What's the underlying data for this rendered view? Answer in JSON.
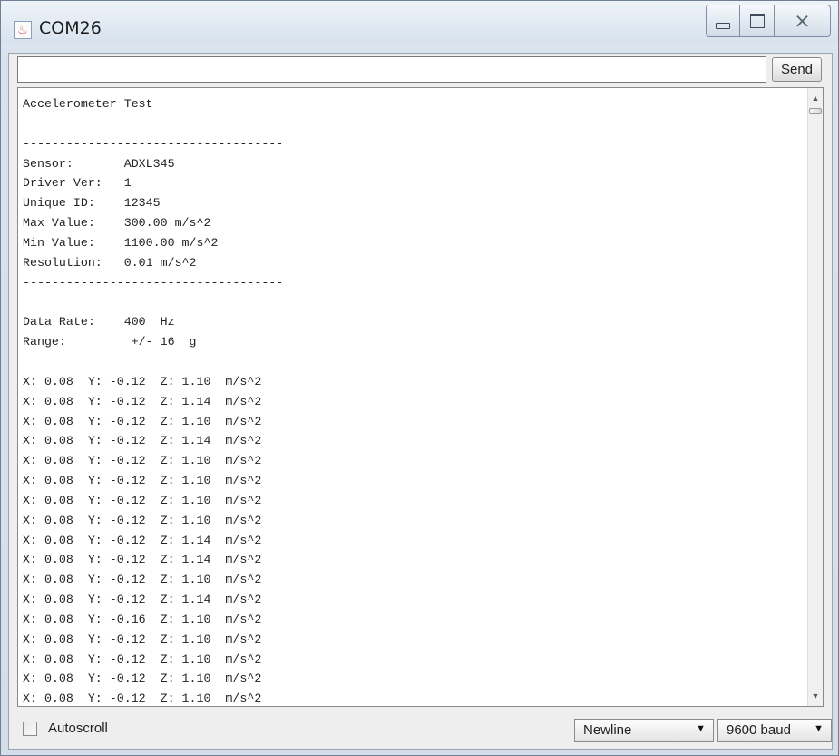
{
  "window": {
    "title": "COM26",
    "icon": "java-cup-icon",
    "buttons": {
      "minimize_icon": "minimize-icon",
      "maximize_icon": "maximize-icon",
      "close_glyph": "⨯"
    }
  },
  "send_bar": {
    "input_value": "",
    "send_label": "Send"
  },
  "serial_output": {
    "lines": [
      "Accelerometer Test",
      "",
      "------------------------------------",
      "Sensor:       ADXL345",
      "Driver Ver:   1",
      "Unique ID:    12345",
      "Max Value:    300.00 m/s^2",
      "Min Value:    1100.00 m/s^2",
      "Resolution:   0.01 m/s^2",
      "------------------------------------",
      "",
      "Data Rate:    400  Hz",
      "Range:         +/- 16  g",
      "",
      "X: 0.08  Y: -0.12  Z: 1.10  m/s^2",
      "X: 0.08  Y: -0.12  Z: 1.14  m/s^2",
      "X: 0.08  Y: -0.12  Z: 1.10  m/s^2",
      "X: 0.08  Y: -0.12  Z: 1.14  m/s^2",
      "X: 0.08  Y: -0.12  Z: 1.10  m/s^2",
      "X: 0.08  Y: -0.12  Z: 1.10  m/s^2",
      "X: 0.08  Y: -0.12  Z: 1.10  m/s^2",
      "X: 0.08  Y: -0.12  Z: 1.10  m/s^2",
      "X: 0.08  Y: -0.12  Z: 1.14  m/s^2",
      "X: 0.08  Y: -0.12  Z: 1.14  m/s^2",
      "X: 0.08  Y: -0.12  Z: 1.10  m/s^2",
      "X: 0.08  Y: -0.12  Z: 1.14  m/s^2",
      "X: 0.08  Y: -0.16  Z: 1.10  m/s^2",
      "X: 0.08  Y: -0.12  Z: 1.10  m/s^2",
      "X: 0.08  Y: -0.12  Z: 1.10  m/s^2",
      "X: 0.08  Y: -0.12  Z: 1.10  m/s^2",
      "X: 0.08  Y: -0.12  Z: 1.10  m/s^2"
    ]
  },
  "bottom_bar": {
    "autoscroll_label": "Autoscroll",
    "autoscroll_checked": false,
    "line_ending": "Newline",
    "baud_rate": "9600 baud"
  }
}
